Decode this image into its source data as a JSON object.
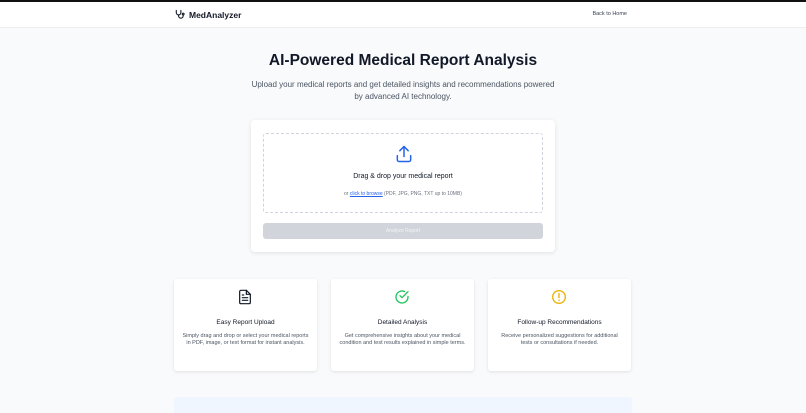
{
  "nav": {
    "brand": "MedAnalyzer",
    "brand_icon": "stethoscope-icon",
    "back_link": "Back to Home"
  },
  "hero": {
    "title": "AI-Powered Medical Report Analysis",
    "subtitle": "Upload your medical reports and get detailed insights and recommendations powered by advanced AI technology."
  },
  "upload": {
    "icon": "upload-icon",
    "title": "Drag & drop your medical report",
    "hint_prefix": "or ",
    "browse_link": "click to browse",
    "hint_suffix": " (PDF, JPG, PNG, TXT up to 10MB)",
    "analyze_button": "Analyze Report"
  },
  "features": [
    {
      "icon": "document-icon",
      "title": "Easy Report Upload",
      "description": "Simply drag and drop or select your medical reports in PDF, image, or text format for instant analysis."
    },
    {
      "icon": "check-circle-icon",
      "title": "Detailed Analysis",
      "description": "Get comprehensive insights about your medical condition and test results explained in simple terms."
    },
    {
      "icon": "alert-circle-icon",
      "title": "Follow-up Recommendations",
      "description": "Receive personalized suggestions for additional tests or consultations if needed."
    }
  ],
  "colors": {
    "accent": "#2563eb",
    "success": "#22c55e",
    "warning": "#eab308",
    "disabled_button": "#d1d5db"
  }
}
